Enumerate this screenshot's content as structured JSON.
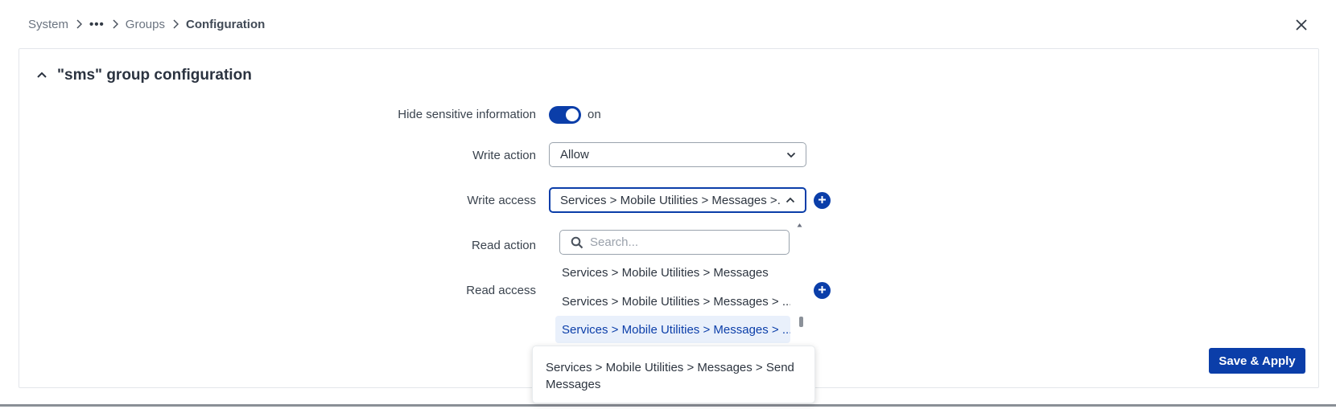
{
  "breadcrumb": {
    "items": [
      "System",
      "•••",
      "Groups"
    ],
    "current": "Configuration"
  },
  "panel": {
    "title": "\"sms\" group configuration"
  },
  "fields": {
    "hide_sensitive": {
      "label": "Hide sensitive information",
      "state": "on"
    },
    "write_action": {
      "label": "Write action",
      "value": "Allow"
    },
    "write_access": {
      "label": "Write access",
      "value": "Services > Mobile Utilities > Messages >..."
    },
    "read_action": {
      "label": "Read action"
    },
    "read_access": {
      "label": "Read access"
    }
  },
  "dropdown": {
    "search_placeholder": "Search...",
    "items": [
      "Services > Mobile Utilities > Messages",
      "Services > Mobile Utilities > Messages > ...",
      "Services > Mobile Utilities > Messages > ..."
    ],
    "active_index": 2
  },
  "tooltip": {
    "text": "Services > Mobile Utilities > Messages > Send Messages"
  },
  "actions": {
    "save_label": "Save & Apply"
  },
  "colors": {
    "accent": "#0b3ea9",
    "active_item_bg": "#e9f0fb"
  }
}
